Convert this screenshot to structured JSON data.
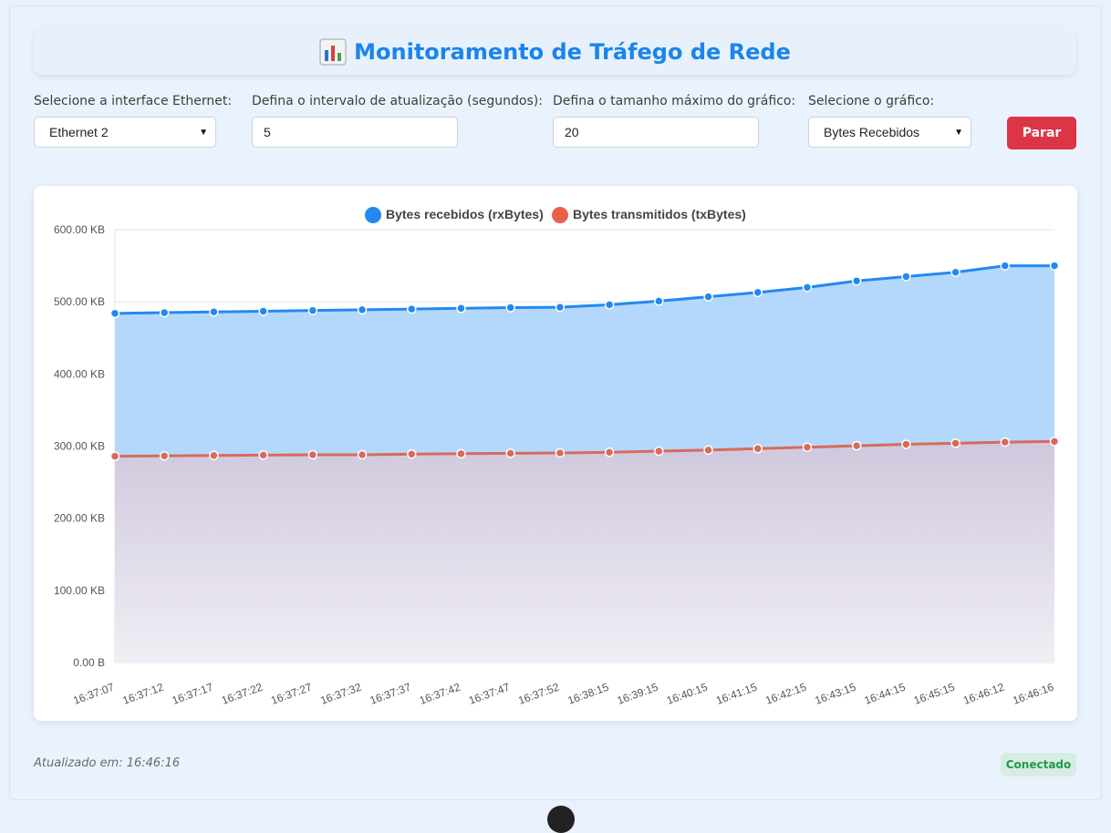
{
  "header": {
    "title": "Monitoramento de Tráfego de Rede",
    "icon": "bar-chart-icon"
  },
  "controls": {
    "interface_label": "Selecione a interface Ethernet:",
    "interface_value": "Ethernet 2",
    "interval_label": "Defina o intervalo de atualização (segundos):",
    "interval_value": "5",
    "max_size_label": "Defina o tamanho máximo do gráfico:",
    "max_size_value": "20",
    "chart_select_label": "Selecione o gráfico:",
    "chart_select_value": "Bytes Recebidos",
    "stop_button": "Parar"
  },
  "colors": {
    "accent": "#1a84ee",
    "rx": "#2389f0",
    "tx": "#e8604c",
    "stop": "#dc3545",
    "status": "#1f9b47"
  },
  "chart_data": {
    "type": "area",
    "x": [
      "16:37:07",
      "16:37:12",
      "16:37:17",
      "16:37:22",
      "16:37:27",
      "16:37:32",
      "16:37:37",
      "16:37:42",
      "16:37:47",
      "16:37:52",
      "16:38:15",
      "16:39:15",
      "16:40:15",
      "16:41:15",
      "16:42:15",
      "16:43:15",
      "16:44:15",
      "16:45:15",
      "16:46:12",
      "16:46:16"
    ],
    "series": [
      {
        "name": "Bytes recebidos (rxBytes)",
        "color": "#2389f0",
        "fill": "rgba(35,137,240,0.32)",
        "values": [
          484,
          485,
          486,
          487,
          488,
          489,
          490,
          491,
          492,
          492.5,
          496,
          501,
          507,
          513,
          520,
          529,
          535,
          541,
          550,
          550
        ]
      },
      {
        "name": "Bytes transmitidos (txBytes)",
        "color": "#e8604c",
        "fill": "rgba(232,96,76,0.06)",
        "values": [
          286,
          286.5,
          287,
          287.5,
          288,
          288,
          289,
          289.5,
          290,
          290.5,
          291.5,
          293,
          294.5,
          296.5,
          298.5,
          300.5,
          302.5,
          304,
          305.5,
          306.5
        ]
      }
    ],
    "yunit": "KB",
    "yticks": [
      "0.00 B",
      "100.00 KB",
      "200.00 KB",
      "300.00 KB",
      "400.00 KB",
      "500.00 KB",
      "600.00 KB"
    ],
    "ylim": [
      0,
      600
    ],
    "grid": true,
    "legend": "top-center"
  },
  "footer": {
    "updated": "Atualizado em: 16:46:16",
    "status": "Conectado"
  }
}
